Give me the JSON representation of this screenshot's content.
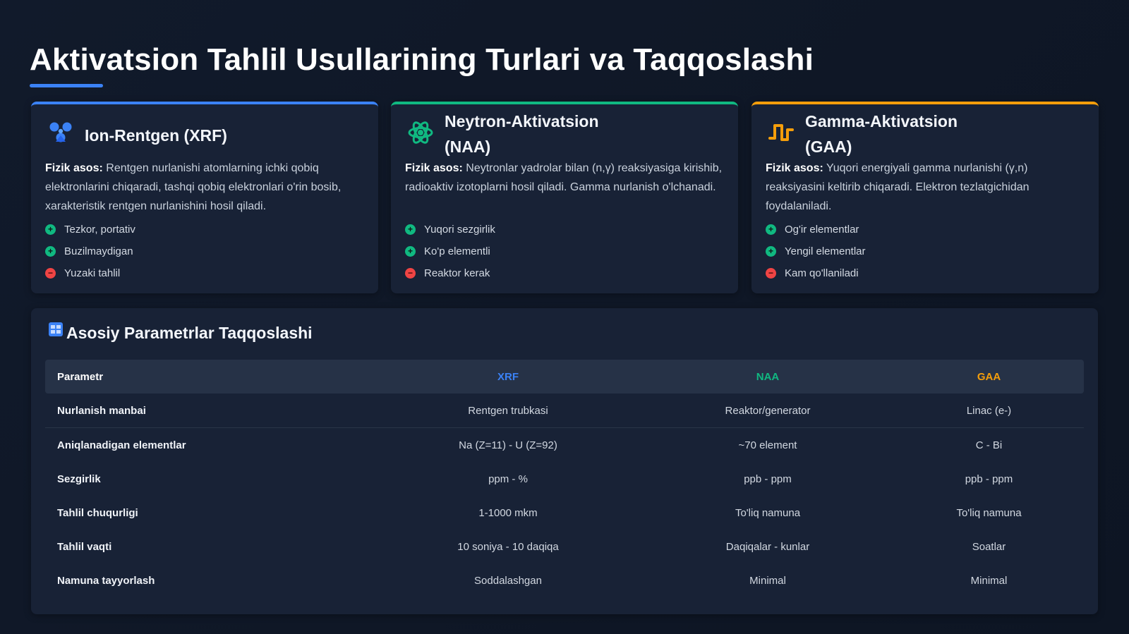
{
  "page": {
    "title": "Aktivatsion Tahlil Usullarining Turlari va Taqqoslashi"
  },
  "colors": {
    "xrf": "#3b82f6",
    "naa": "#10b981",
    "gaa": "#f59e0b",
    "positive": "#10b981",
    "negative": "#ef4444"
  },
  "cards": [
    {
      "icon": "radiation-icon",
      "title_line1": "Ion-Rentgen (XRF)",
      "title_line2": "",
      "desc_label": "Fizik asos:",
      "desc_text": " Rentgen nurlanishi atomlarning ichki qobiq elektronlarini chiqaradi, tashqi qobiq elektronlari o'rin bosib, xarakteristik rentgen nurlanishini hosil qiladi.",
      "features": [
        {
          "text": "Tezkor, portativ",
          "type": "plus"
        },
        {
          "text": "Buzilmaydigan",
          "type": "plus"
        },
        {
          "text": "Yuzaki tahlil",
          "type": "minus"
        }
      ]
    },
    {
      "icon": "atom-icon",
      "title_line1": "Neytron-Aktivatsion",
      "title_line2": "(NAA)",
      "desc_label": "Fizik asos:",
      "desc_text": " Neytronlar yadrolar bilan (n,γ) reaksiyasiga kirishib, radioaktiv izotoplarni hosil qiladi. Gamma nurlanish o'lchanadi.",
      "features": [
        {
          "text": "Yuqori sezgirlik",
          "type": "plus"
        },
        {
          "text": "Ko'p elementli",
          "type": "plus"
        },
        {
          "text": "Reaktor kerak",
          "type": "minus"
        }
      ]
    },
    {
      "icon": "wave-icon",
      "title_line1": "Gamma-Aktivatsion",
      "title_line2": "(GAA)",
      "desc_label": "Fizik asos:",
      "desc_text": " Yuqori energiyali gamma nurlanishi (γ,n) reaksiyasini keltirib chiqaradi. Elektron tezlatgichidan foydalaniladi.",
      "features": [
        {
          "text": "Og'ir elementlar",
          "type": "plus"
        },
        {
          "text": "Yengil elementlar",
          "type": "plus"
        },
        {
          "text": "Kam qo'llaniladi",
          "type": "minus"
        }
      ]
    }
  ],
  "comparison": {
    "icon": "table-icon",
    "title": "Asosiy Parametrlar Taqqoslashi",
    "headers": [
      "Parametr",
      "XRF",
      "NAA",
      "GAA"
    ],
    "rows": [
      [
        "Nurlanish manbai",
        "Rentgen trubkasi",
        "Reaktor/generator",
        "Linac (e-)"
      ],
      [
        "Aniqlanadigan elementlar",
        "Na (Z=11) - U (Z=92)",
        "~70 element",
        "C - Bi"
      ],
      [
        "Sezgirlik",
        "ppm - %",
        "ppb - ppm",
        "ppb - ppm"
      ],
      [
        "Tahlil chuqurligi",
        "1-1000 mkm",
        "To'liq namuna",
        "To'liq namuna"
      ],
      [
        "Tahlil vaqti",
        "10 soniya - 10 daqiqa",
        "Daqiqalar - kunlar",
        "Soatlar"
      ],
      [
        "Namuna tayyorlash",
        "Soddalashgan",
        "Minimal",
        "Minimal"
      ]
    ]
  }
}
